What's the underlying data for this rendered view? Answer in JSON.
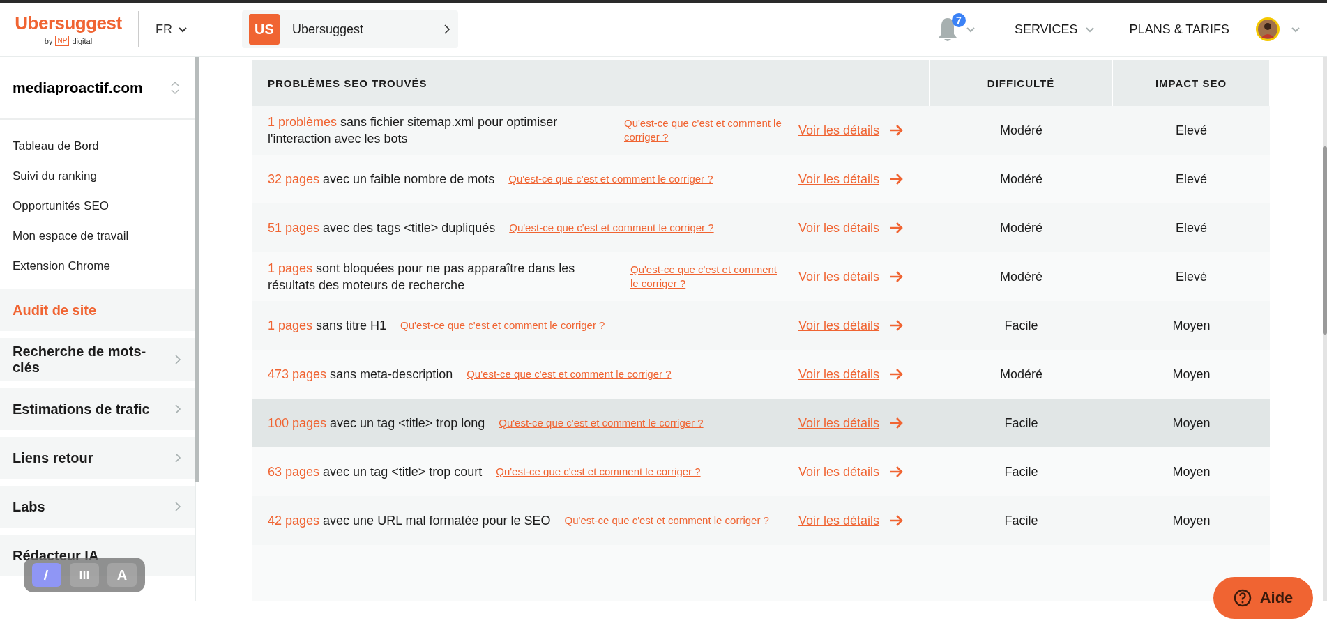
{
  "header": {
    "logo": {
      "name": "Ubersuggest",
      "byline": "by",
      "badge": "NP",
      "suffix": "digital"
    },
    "language": "FR",
    "project": {
      "initials": "US",
      "name": "Ubersuggest"
    },
    "notifications": {
      "count": "7"
    },
    "nav": [
      "SERVICES",
      "PLANS & TARIFS"
    ]
  },
  "sidebar": {
    "domain": "mediaproactif.com",
    "links": [
      {
        "label": "Tableau de Bord"
      },
      {
        "label": "Suivi du ranking"
      },
      {
        "label": "Opportunités SEO"
      },
      {
        "label": "Mon espace de travail"
      },
      {
        "label": "Extension Chrome"
      }
    ],
    "sections": [
      {
        "label": "Audit de site",
        "selected": true,
        "chevron": false
      },
      {
        "label": "Recherche de mots-clés",
        "selected": false,
        "chevron": true
      },
      {
        "label": "Estimations de trafic",
        "selected": false,
        "chevron": true
      },
      {
        "label": "Liens retour",
        "selected": false,
        "chevron": true
      },
      {
        "label": "Labs",
        "selected": false,
        "chevron": true
      },
      {
        "label": "Rédacteur IA",
        "selected": false,
        "chevron": false
      }
    ]
  },
  "overlay_toolbar": {
    "buttons": [
      {
        "kind": "icon",
        "selected": true
      },
      {
        "kind": "icon",
        "selected": false
      },
      {
        "kind": "text",
        "label": "A",
        "selected": false
      }
    ]
  },
  "table": {
    "columns": [
      "PROBLÈMES SEO TROUVÉS",
      "DIFFICULTÉ",
      "IMPACT SEO"
    ],
    "rows": [
      {
        "count": "1 problèmes",
        "text": "sans fichier sitemap.xml pour optimiser l'interaction avec les bots",
        "help": "Qu'est-ce que c'est et comment le corriger ?",
        "details": "Voir les détails",
        "difficulty": "Modéré",
        "impact": "Elevé",
        "highlighted": false
      },
      {
        "count": "32 pages",
        "text": "avec un faible nombre de mots",
        "help": "Qu'est-ce que c'est et comment le corriger ?",
        "details": "Voir les détails",
        "difficulty": "Modéré",
        "impact": "Elevé",
        "highlighted": false
      },
      {
        "count": "51 pages",
        "text": "avec des tags <title> dupliqués",
        "help": "Qu'est-ce que c'est et comment le corriger ?",
        "details": "Voir les détails",
        "difficulty": "Modéré",
        "impact": "Elevé",
        "highlighted": false
      },
      {
        "count": "1 pages",
        "text": "sont bloquées pour ne pas apparaître dans les résultats des moteurs de recherche",
        "help": "Qu'est-ce que c'est et comment le corriger ?",
        "details": "Voir les détails",
        "difficulty": "Modéré",
        "impact": "Elevé",
        "highlighted": false
      },
      {
        "count": "1 pages",
        "text": "sans titre H1",
        "help": "Qu'est-ce que c'est et comment le corriger ?",
        "details": "Voir les détails",
        "difficulty": "Facile",
        "impact": "Moyen",
        "highlighted": false
      },
      {
        "count": "473 pages",
        "text": "sans meta-description",
        "help": "Qu'est-ce que c'est et comment le corriger ?",
        "details": "Voir les détails",
        "difficulty": "Modéré",
        "impact": "Moyen",
        "highlighted": false
      },
      {
        "count": "100 pages",
        "text": "avec un tag <title> trop long",
        "help": "Qu'est-ce que c'est et comment le corriger ?",
        "details": "Voir les détails",
        "difficulty": "Facile",
        "impact": "Moyen",
        "highlighted": true
      },
      {
        "count": "63 pages",
        "text": "avec un tag <title> trop court",
        "help": "Qu'est-ce que c'est et comment le corriger ?",
        "details": "Voir les détails",
        "difficulty": "Facile",
        "impact": "Moyen",
        "highlighted": false
      },
      {
        "count": "42 pages",
        "text": "avec une URL mal formatée pour le SEO",
        "help": "Qu'est-ce que c'est et comment le corriger ?",
        "details": "Voir les détails",
        "difficulty": "Facile",
        "impact": "Moyen",
        "highlighted": false
      }
    ]
  },
  "help_button": {
    "label": "Aide"
  }
}
